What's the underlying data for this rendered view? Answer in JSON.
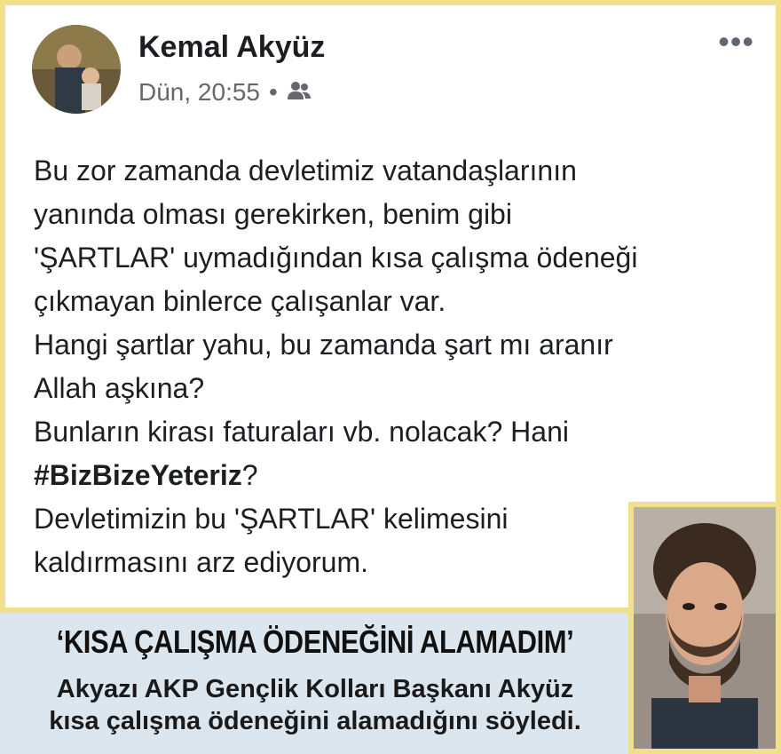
{
  "post": {
    "author": "Kemal Akyüz",
    "time": "Dün, 20:55",
    "separator": "•",
    "privacy_icon": "friends-icon",
    "menu_label": "•••",
    "lines": [
      "Bu zor zamanda devletimiz vatandaşlarının",
      "yanında olması gerekirken, benim gibi",
      "'ŞARTLAR' uymadığından kısa çalışma ödeneği",
      "çıkmayan binlerce çalışanlar var.",
      "Hangi şartlar yahu, bu zamanda şart mı aranır",
      "Allah aşkına?",
      "Bunların kirası faturaları vb. nolacak? Hani",
      "",
      "Devletimizin bu 'ŞARTLAR' kelimesini",
      "kaldırmasını arz ediyorum."
    ],
    "hashtag": "#BizBizeYeteriz",
    "hashtag_suffix": "?"
  },
  "caption": {
    "headline": "‘KISA ÇALIŞMA ÖDENEĞİNİ ALAMADIM’",
    "subtitle_line1": "Akyazı AKP Gençlik Kolları Başkanı Akyüz",
    "subtitle_line2": "kısa çalışma ödeneğini alamadığını söyledi."
  },
  "colors": {
    "frame": "#f0e08c",
    "caption_bg": "#dbe6ef",
    "meta_text": "#65676b"
  }
}
